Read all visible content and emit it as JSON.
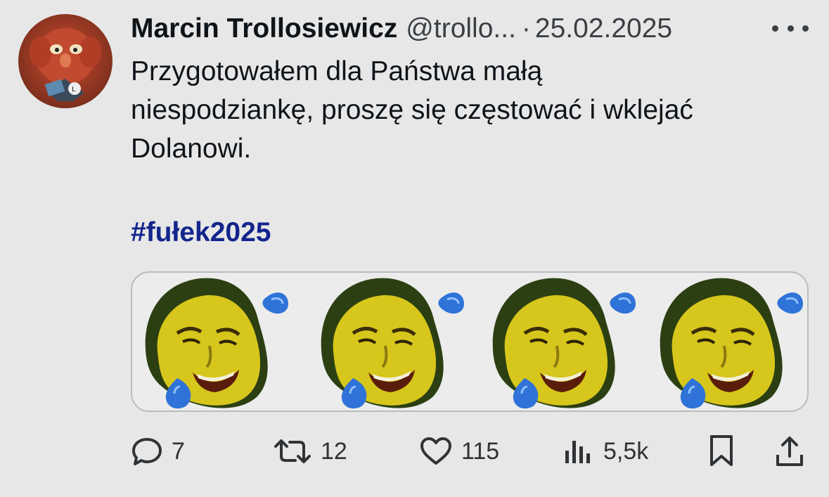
{
  "tweet": {
    "author_name": "Marcin Trollosiewicz",
    "handle": "@trollo...",
    "separator": "·",
    "date": "25.02.2025",
    "text_lines": [
      "Przygotowałem dla Państwa małą",
      "niespodziankę, proszę się częstować i wklejać",
      "Dolanowi."
    ],
    "hashtag": "#fułek2025"
  },
  "actions": {
    "replies": "7",
    "retweets": "12",
    "likes": "115",
    "views": "5,5k"
  },
  "icons": {
    "more": "more-dots-icon",
    "reply": "reply-bubble-icon",
    "retweet": "retweet-icon",
    "like": "heart-icon",
    "views": "views-bars-icon",
    "bookmark": "bookmark-icon",
    "share": "share-upload-icon"
  },
  "colors": {
    "background": "#e7e7e7",
    "hashtag": "#13258c",
    "text": "#0f1419",
    "muted": "#3a3f44"
  }
}
